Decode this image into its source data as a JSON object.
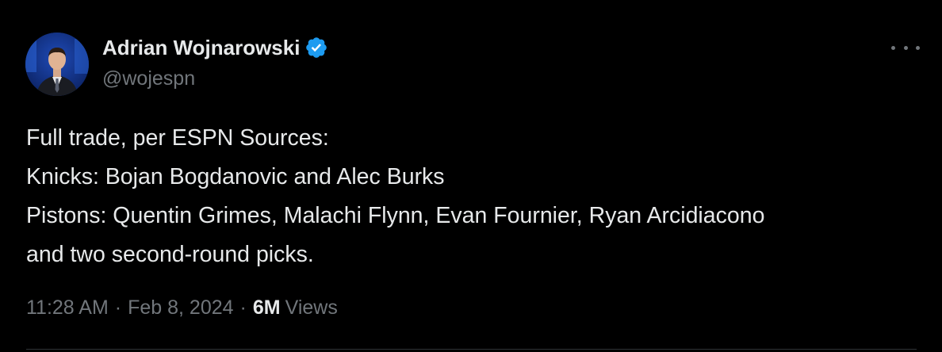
{
  "author": {
    "display_name": "Adrian Wojnarowski",
    "handle": "@wojespn",
    "verified": true,
    "verified_color": "#1d9bf0",
    "avatar_icon": "profile-photo"
  },
  "tweet": {
    "lines": [
      "Full trade, per ESPN Sources:",
      "Knicks: Bojan Bogdanovic and Alec Burks",
      "Pistons: Quentin Grimes, Malachi Flynn, Evan Fournier, Ryan Arcidiacono",
      "and two second-round picks."
    ]
  },
  "meta": {
    "time": "11:28 AM",
    "separator": "·",
    "date": "Feb 8, 2024",
    "views_count": "6M",
    "views_label": "Views"
  },
  "actions": {
    "more_icon": "more-horizontal-icon"
  },
  "colors": {
    "background": "#000000",
    "primary_text": "#e7e9ea",
    "secondary_text": "#71767b",
    "divider": "#2f3336"
  }
}
